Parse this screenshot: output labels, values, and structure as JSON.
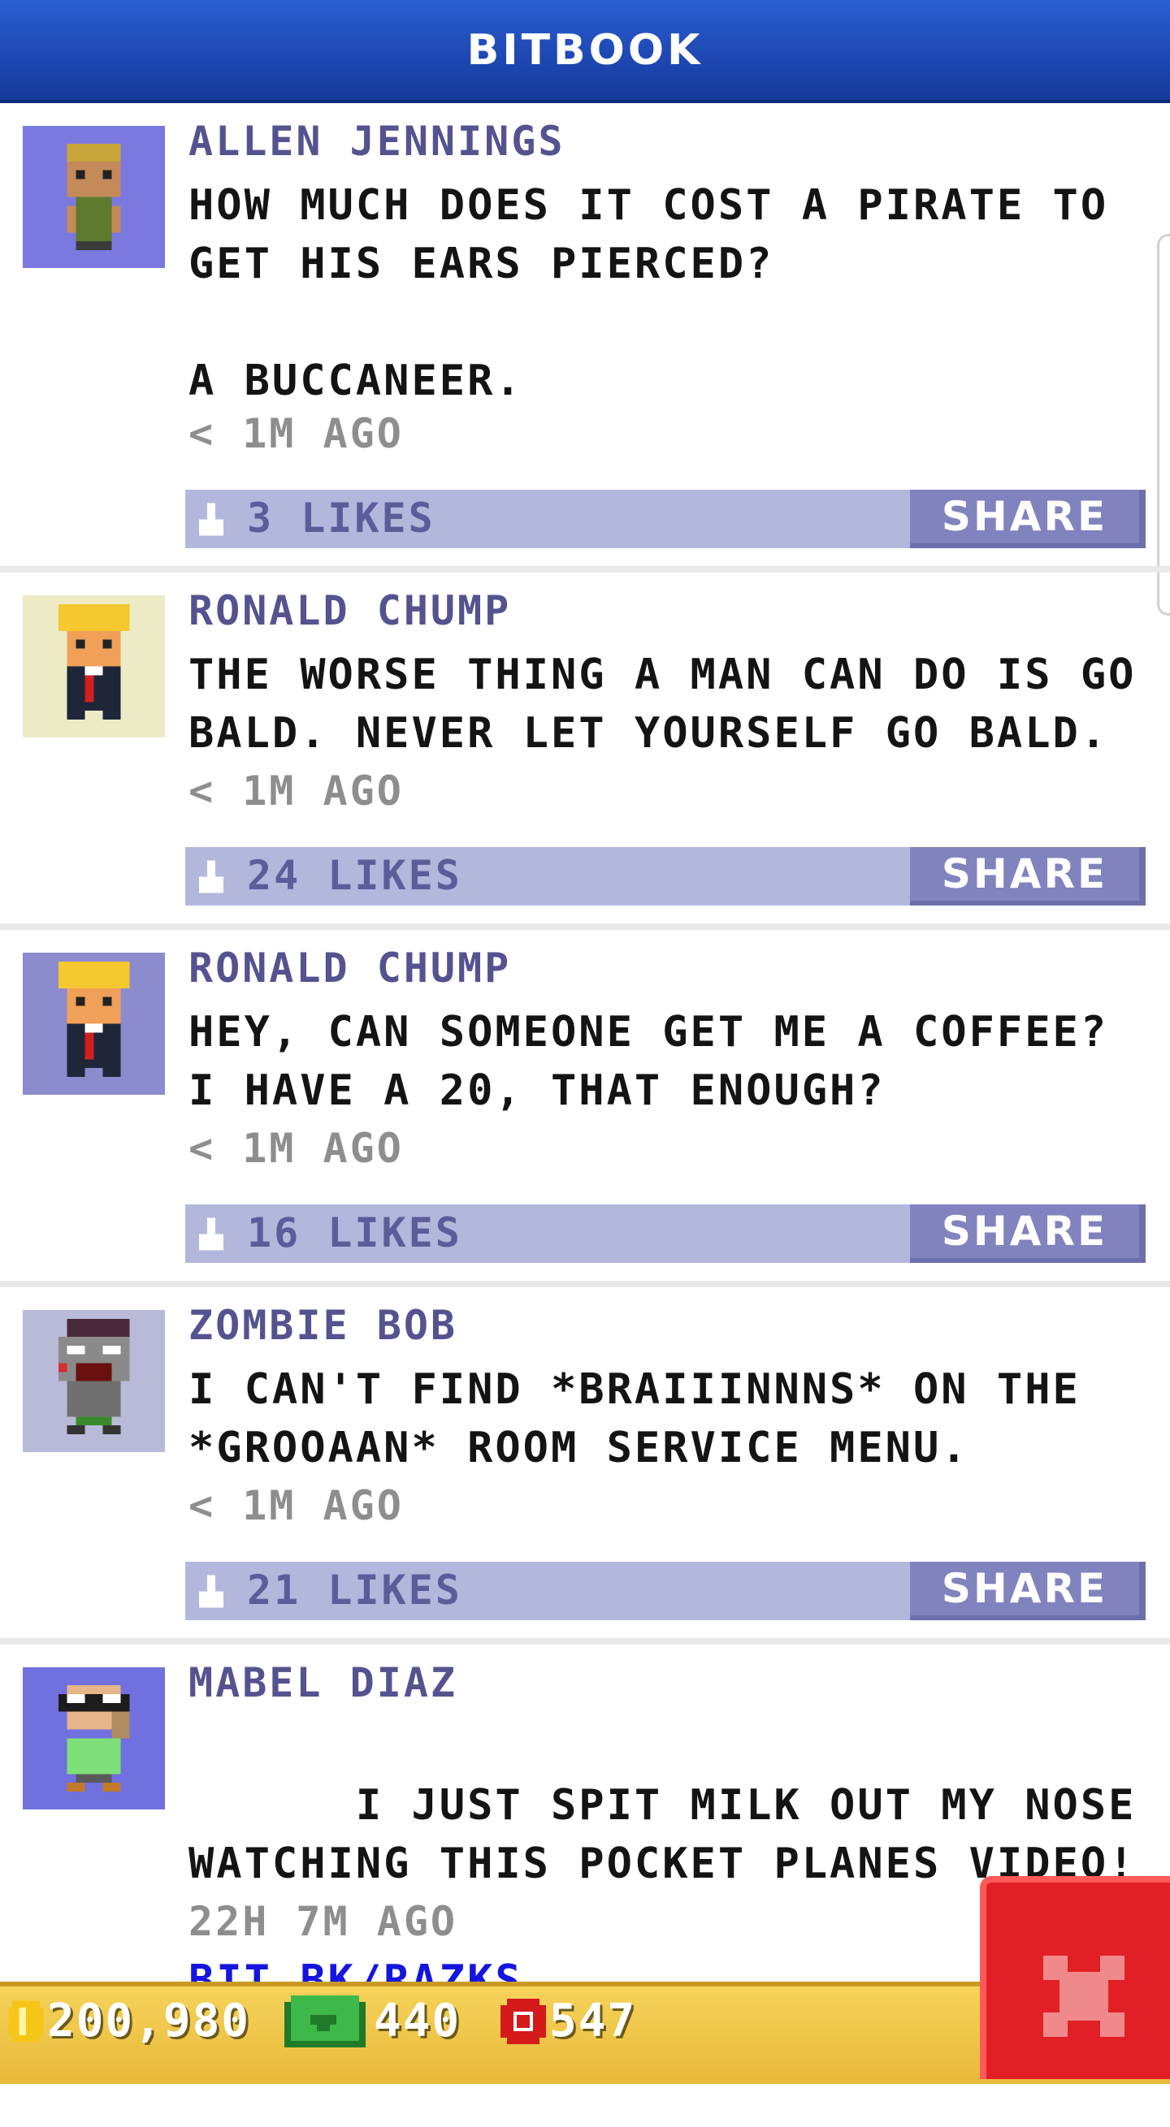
{
  "header": {
    "title": "BITBOOK"
  },
  "posts": [
    {
      "author": "ALLEN JENNINGS",
      "message": "HOW MUCH DOES IT COST A PIRATE TO\nGET HIS EARS PIERCED?\n\nA BUCCANEER.",
      "time": "< 1M AGO",
      "likes": "3 LIKES",
      "share": "SHARE",
      "avatar_bg": "#7b79e0"
    },
    {
      "author": "RONALD CHUMP",
      "message": "THE WORSE THING A MAN CAN DO IS GO\nBALD. NEVER LET YOURSELF GO BALD.",
      "time": "< 1M AGO",
      "likes": "24 LIKES",
      "share": "SHARE",
      "avatar_bg": "#ecebc6"
    },
    {
      "author": "RONALD CHUMP",
      "message": "HEY, CAN SOMEONE GET ME A COFFEE?\nI HAVE A 20, THAT ENOUGH?",
      "time": "< 1M AGO",
      "likes": "16 LIKES",
      "share": "SHARE",
      "avatar_bg": "#8b8bce"
    },
    {
      "author": "ZOMBIE BOB",
      "message": "I CAN'T FIND *BRAIIINNNS* ON THE\n*GROOAAN* ROOM SERVICE MENU.",
      "time": "< 1M AGO",
      "likes": "21 LIKES",
      "share": "SHARE",
      "avatar_bg": "#b9bad8"
    },
    {
      "author": "MABEL DIAZ",
      "message": "I JUST SPIT MILK OUT MY NOSE\nWATCHING THIS POCKET PLANES VIDEO!",
      "link": "BIT.BK/RAZKS",
      "time": "22H 7M AGO",
      "avatar_bg": "#7070de"
    }
  ],
  "bottom_bar": {
    "coins": "200,980",
    "bux": "440",
    "tickets": "547"
  },
  "colors": {
    "header": "#1e47b2",
    "author": "#55538f",
    "likes_bar": "#b4b7dc",
    "share_button": "#8183be",
    "link": "#1515e0",
    "bottom_bar": "#e7b93a",
    "close_button": "#e21f26"
  },
  "icons": [
    "like-icon",
    "coin-icon",
    "bux-icon",
    "ticket-icon",
    "close-icon"
  ]
}
